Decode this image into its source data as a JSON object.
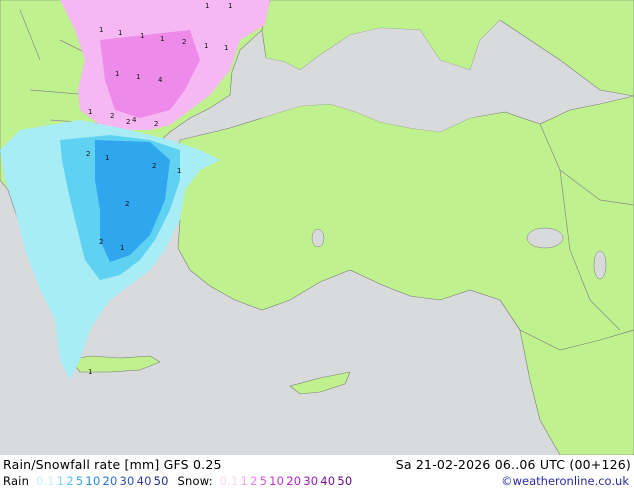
{
  "title": "Rain/Snowfall rate [mm] GFS 0.25",
  "datetime": "Sa 21-02-2026 06..06 UTC (00+126)",
  "legend": {
    "rain_label": "Rain",
    "rain_levels": [
      {
        "label": "0.1",
        "color": "#c8f0f8"
      },
      {
        "label": "1",
        "color": "#7edcf0"
      },
      {
        "label": "2",
        "color": "#4ec4ee"
      },
      {
        "label": "5",
        "color": "#32aaf0"
      },
      {
        "label": "10",
        "color": "#1a8ce6"
      },
      {
        "label": "20",
        "color": "#2a6fd0"
      },
      {
        "label": "30",
        "color": "#2a54b8"
      },
      {
        "label": "40",
        "color": "#303ca0"
      },
      {
        "label": "50",
        "color": "#282a88"
      }
    ],
    "snow_label": "Snow:",
    "snow_levels": [
      {
        "label": "0.1",
        "color": "#f6d8f4"
      },
      {
        "label": "1",
        "color": "#f0a8ec"
      },
      {
        "label": "2",
        "color": "#e880e6"
      },
      {
        "label": "5",
        "color": "#dc50dc"
      },
      {
        "label": "10",
        "color": "#c832d0"
      },
      {
        "label": "20",
        "color": "#b020c0"
      },
      {
        "label": "30",
        "color": "#9818b0"
      },
      {
        "label": "40",
        "color": "#8010a0"
      },
      {
        "label": "50",
        "color": "#680890"
      }
    ]
  },
  "copyright": "©weatheronline.co.uk",
  "colors": {
    "land": "#bff28e",
    "sea": "#d9dadb",
    "border": "#8a8a8a",
    "rain_light": "#a8ecf6",
    "rain_mid": "#5fd2f2",
    "rain_heavy": "#2fa6ee",
    "snow_light": "#f6b8f2",
    "snow_mid": "#ee8aea"
  },
  "markers": [
    "1",
    "1",
    "1",
    "1",
    "1",
    "2",
    "1",
    "1",
    "1",
    "1",
    "1",
    "4",
    "2",
    "2",
    "4",
    "2",
    "1",
    "2",
    "1",
    "2",
    "1",
    "2",
    "2",
    "1",
    "1"
  ]
}
